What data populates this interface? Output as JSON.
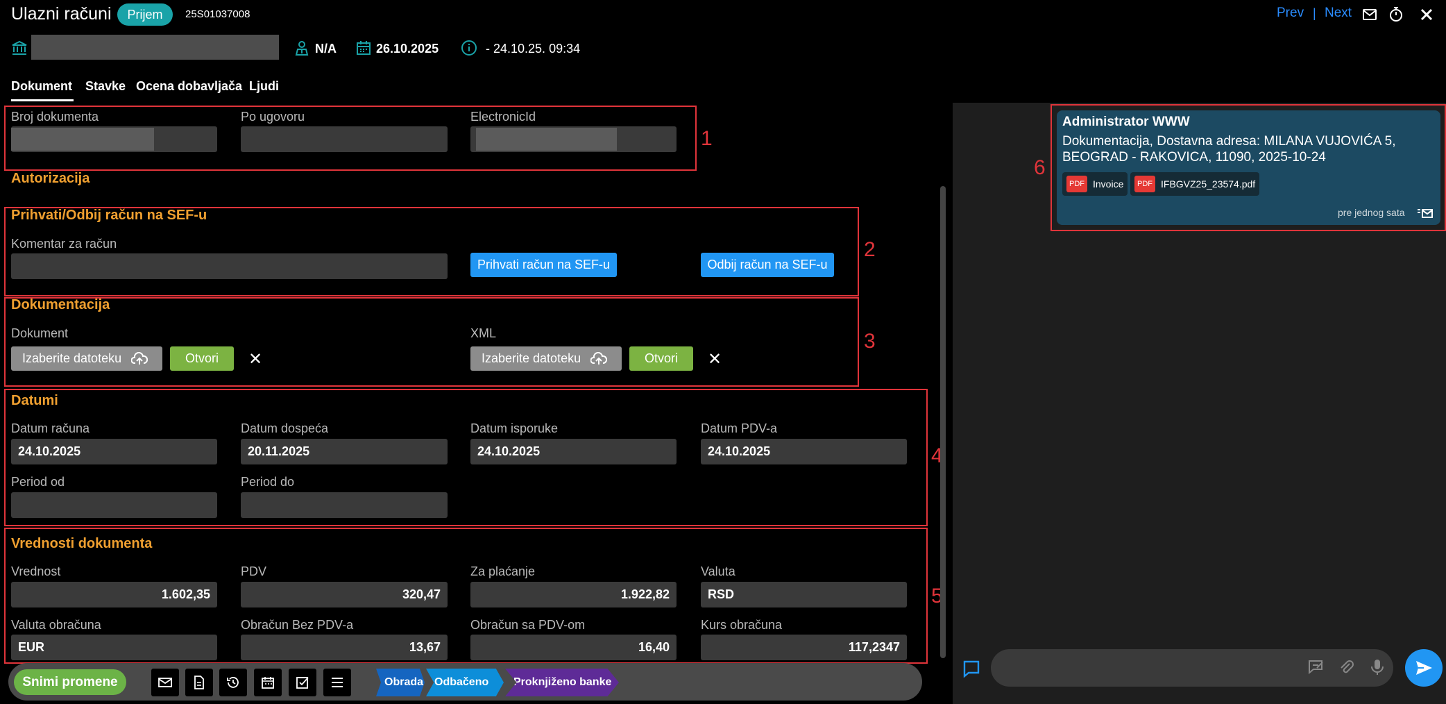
{
  "header": {
    "title": "Ulazni računi",
    "status": "Prijem",
    "doc_number": "25S01037008",
    "prev": "Prev",
    "separator": "|",
    "next": "Next",
    "assignee": "N/A",
    "date": "26.10.2025",
    "timestamp": "- 24.10.25. 09:34"
  },
  "tabs": [
    "Dokument",
    "Stavke",
    "Ocena dobavljača",
    "Ljudi"
  ],
  "section1": {
    "label_broj": "Broj dokumenta",
    "label_ugovor": "Po ugovoru",
    "label_eid": "ElectronicId",
    "marker": "1"
  },
  "autorizacija": "Autorizacija",
  "section2": {
    "title": "Prihvati/Odbij račun na SEF-u",
    "label_komentar": "Komentar za račun",
    "accept": "Prihvati račun na SEF-u",
    "reject": "Odbij račun na SEF-u",
    "marker": "2"
  },
  "section3": {
    "title": "Dokumentacija",
    "label_dokument": "Dokument",
    "label_xml": "XML",
    "choose": "Izaberite datoteku",
    "open": "Otvori",
    "remove": "✕",
    "marker": "3"
  },
  "section4": {
    "title": "Datumi",
    "labels": [
      "Datum računa",
      "Datum dospeća",
      "Datum isporuke",
      "Datum PDV-a",
      "Period od",
      "Period do"
    ],
    "values": [
      "24.10.2025",
      "20.11.2025",
      "24.10.2025",
      "24.10.2025",
      "",
      ""
    ],
    "marker": "4"
  },
  "section5": {
    "title": "Vrednosti dokumenta",
    "labels": [
      "Vrednost",
      "PDV",
      "Za plaćanje",
      "Valuta",
      "Valuta obračuna",
      "Obračun Bez PDV-a",
      "Obračun sa PDV-om",
      "Kurs obračuna"
    ],
    "values": [
      "1.602,35",
      "320,47",
      "1.922,82",
      "RSD",
      "EUR",
      "13,67",
      "16,40",
      "117,2347"
    ],
    "marker": "5"
  },
  "bottom": {
    "save": "Snimi promene",
    "workflow": [
      "Obrada",
      "Odbačeno",
      "Proknjiženo banke"
    ],
    "workflow_colors": [
      "#1565c0",
      "#0d8ed9",
      "#5e2b97"
    ]
  },
  "chat": {
    "author": "Administrator WWW",
    "body": "Dokumentacija, Dostavna adresa: MILANA VUJOVIĆA 5, BEOGRAD - RAKOVICA, 11090, 2025-10-24",
    "attachments": [
      "Invoice",
      "IFBGVZ25_23574.pdf"
    ],
    "pdf_badge": "PDF",
    "time": "pre jednog sata",
    "marker": "6"
  },
  "colors": {
    "accent_orange": "#f0a030",
    "annotation_red": "#e0343a",
    "link_blue": "#2a8cff"
  }
}
